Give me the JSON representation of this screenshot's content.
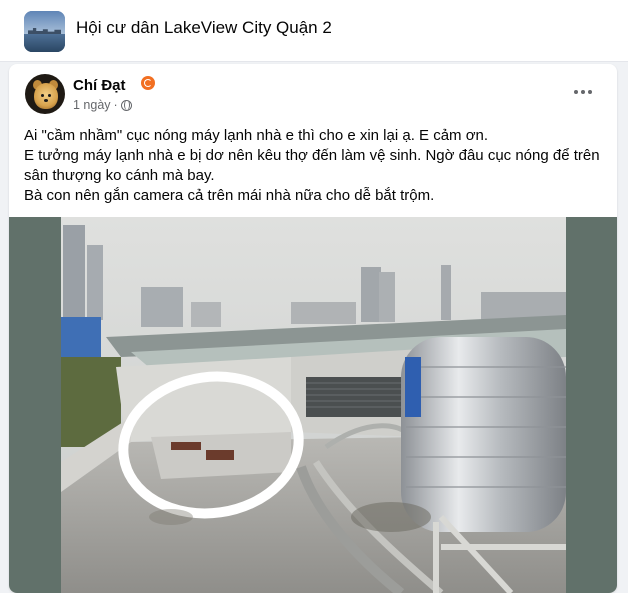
{
  "group": {
    "title": "Hội cư dân LakeView City Quận 2",
    "thumbnail_icon": "group-cover-thumbnail"
  },
  "post": {
    "author": "Chí Đạt",
    "author_badge_icon": "orange-badge-icon",
    "time": "1 ngày",
    "separator": "·",
    "audience_icon": "globe-icon",
    "more_icon": "more-horizontal-icon",
    "text_lines": [
      "Ai \"cầm nhầm\" cục nóng máy lạnh nhà e thì cho e xin lại ạ. E cảm ơn.",
      "E tưởng máy lạnh nhà e bị dơ nên kêu thợ đến làm vệ sinh. Ngờ đâu cục nóng để trên sân thượng ko cánh mà bay.",
      "Bà con nên gắn camera cả trên mái nhà nữa cho dễ bắt trộm."
    ],
    "photo_description_icon": "rooftop-photo"
  },
  "colors": {
    "card_bg": "#ffffff",
    "page_bg": "#f0f2f5",
    "secondary_text": "#65676b",
    "badge": "#f26f21",
    "photo_side": "#61716a"
  }
}
